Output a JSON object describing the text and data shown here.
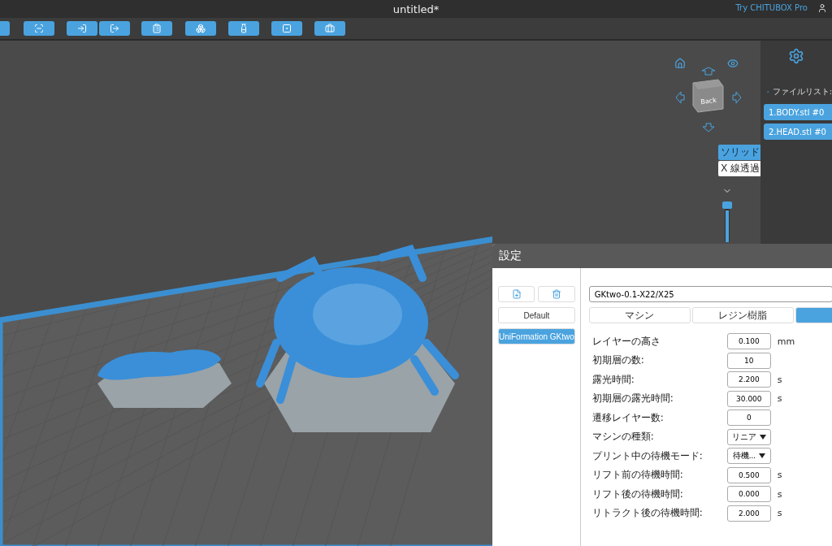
{
  "window": {
    "title": "untitled*",
    "promo_link": "Try CHITUBOX Pro"
  },
  "view_cube": {
    "face_label": "Back"
  },
  "render_modes": [
    {
      "label": "ソリッド",
      "selected": true
    },
    {
      "label": "X 線透過",
      "selected": false
    }
  ],
  "layer_slider": {
    "level": 1
  },
  "file_list": {
    "title": "ファイルリスト:",
    "items": [
      {
        "label": "1.BODY.stl #0",
        "selected": true
      },
      {
        "label": "2.HEAD.stl #0",
        "selected": true
      }
    ]
  },
  "settings_dialog": {
    "title": "設定",
    "profiles": [
      {
        "label": "Default",
        "selected": false
      },
      {
        "label": "UniFormation GKtwo",
        "selected": true
      }
    ],
    "profile_name": "GKtwo-0.1-X22/X25",
    "tabs": [
      {
        "label": "マシン",
        "selected": false
      },
      {
        "label": "レジン樹脂",
        "selected": false
      },
      {
        "selected": true
      }
    ],
    "params": [
      {
        "label": "レイヤーの高さ",
        "kind": "input",
        "value": "0.100",
        "unit": "mm"
      },
      {
        "label": "初期層の数:",
        "kind": "input",
        "value": "10"
      },
      {
        "label": "露光時間:",
        "kind": "input",
        "value": "2.200",
        "unit": "s"
      },
      {
        "label": "初期層の露光時間:",
        "kind": "input",
        "value": "30.000",
        "unit": "s"
      },
      {
        "label": "遷移レイヤー数:",
        "kind": "input",
        "value": "0"
      },
      {
        "label": "マシンの種類:",
        "kind": "select",
        "value": "リニア"
      },
      {
        "label": "プリント中の待機モード:",
        "kind": "select",
        "value": "待機..."
      },
      {
        "label": "リフト前の待機時間:",
        "kind": "input",
        "value": "0.500",
        "unit": "s"
      },
      {
        "label": "リフト後の待機時間:",
        "kind": "input",
        "value": "0.000",
        "unit": "s"
      },
      {
        "label": "リトラクト後の待機時間:",
        "kind": "input",
        "value": "2.000",
        "unit": "s"
      }
    ]
  }
}
